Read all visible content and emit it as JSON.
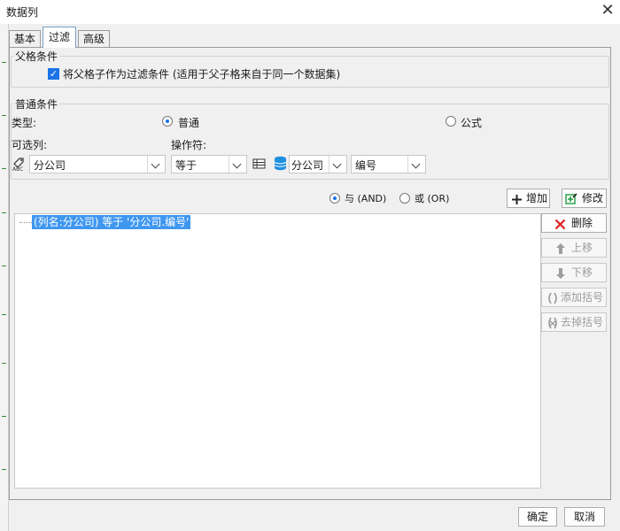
{
  "window": {
    "title": "数据列",
    "close_glyph": "✕"
  },
  "tabs": [
    {
      "label": "基本",
      "active": false
    },
    {
      "label": "过滤",
      "active": true
    },
    {
      "label": "高级",
      "active": false
    }
  ],
  "parent_condition": {
    "legend": "父格条件",
    "checkbox_checked": true,
    "checkbox_label": "将父格子作为过滤条件 (适用于父子格来自于同一个数据集)"
  },
  "normal_condition": {
    "legend": "普通条件",
    "type_label": "类型:",
    "type_options": [
      {
        "label": "普通",
        "selected": true
      },
      {
        "label": "公式",
        "selected": false
      }
    ],
    "column_label": "可选列:",
    "operator_label": "操作符:",
    "column_value": "分公司",
    "operator_value": "等于",
    "dataset_column_value": "分公司",
    "field_value": "编号"
  },
  "logic": {
    "and_label": "与 (AND)",
    "and_selected": true,
    "or_label": "或 (OR)",
    "add_label": "增加",
    "modify_label": "修改"
  },
  "condition_list": [
    "(列名:分公司) 等于 '分公司.编号'"
  ],
  "side_buttons": {
    "delete": "删除",
    "move_up": "上移",
    "move_down": "下移",
    "add_bracket": "添加括号",
    "remove_bracket": "去掉括号"
  },
  "footer": {
    "ok": "确定",
    "cancel": "取消"
  },
  "colors": {
    "accent": "#1a73e8",
    "selection": "#3f97f0",
    "delete_red": "#e02020",
    "add_green": "#1c9a3c"
  },
  "icons": [
    "close-icon",
    "checkmark-icon",
    "abc-column-icon",
    "chevron-down-icon",
    "table-icon",
    "database-icon",
    "plus-icon",
    "edit-icon",
    "delete-x-icon",
    "arrow-up-icon",
    "arrow-down-icon",
    "add-bracket-icon",
    "remove-bracket-icon"
  ]
}
